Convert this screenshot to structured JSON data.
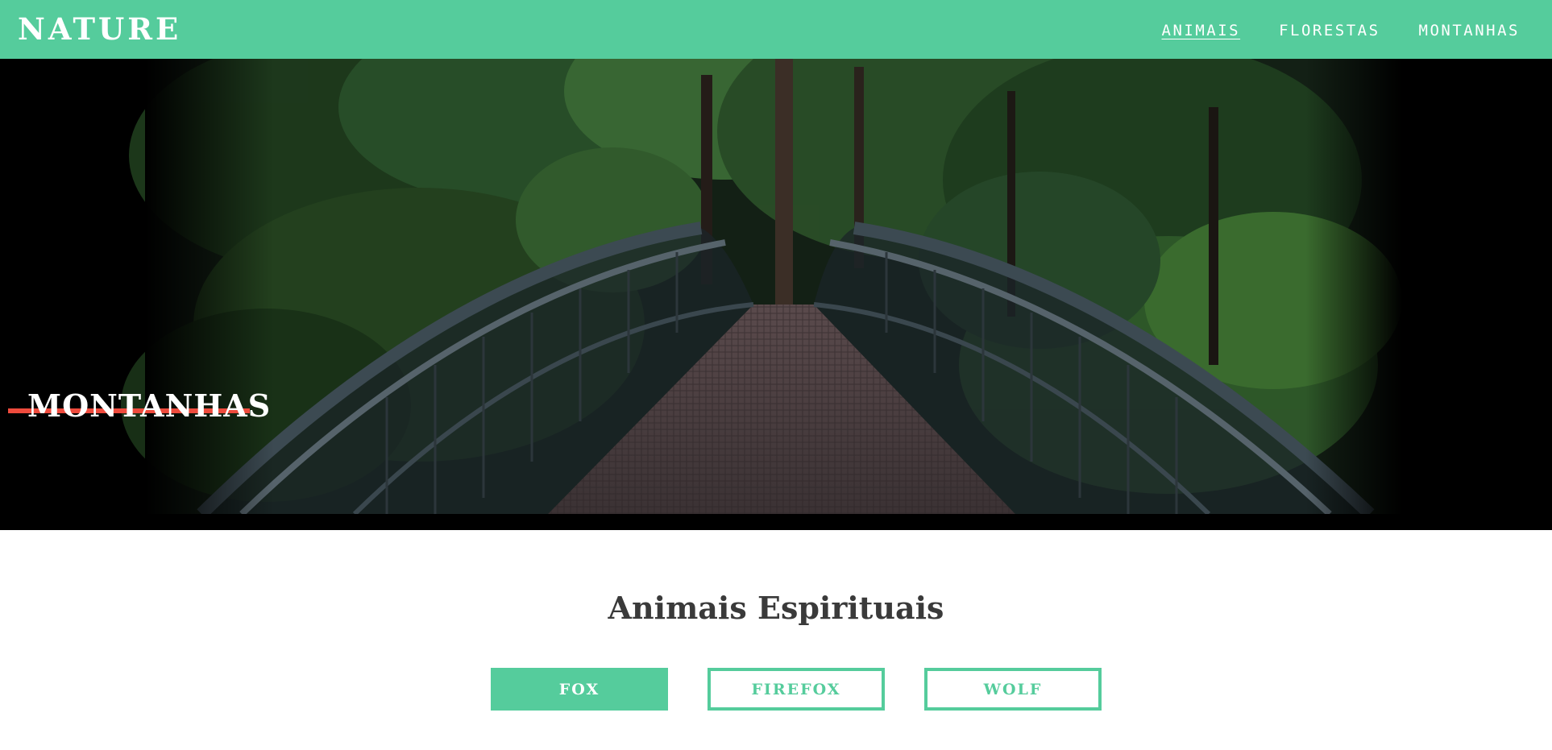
{
  "header": {
    "brand": "NATURE",
    "nav": [
      {
        "label": "ANIMAIS",
        "active": true
      },
      {
        "label": "FLORESTAS",
        "active": false
      },
      {
        "label": "MONTANHAS",
        "active": false
      }
    ]
  },
  "hero": {
    "title": "MONTANHAS",
    "image": "forest-bridge-photo"
  },
  "section": {
    "title": "Animais Espirituais",
    "buttons": [
      {
        "label": "FOX",
        "active": true
      },
      {
        "label": "FIREFOX",
        "active": false
      },
      {
        "label": "WOLF",
        "active": false
      }
    ]
  },
  "colors": {
    "brand": "#55cc9c",
    "accent": "#ee4b3d",
    "heading": "#3a3a3a"
  }
}
